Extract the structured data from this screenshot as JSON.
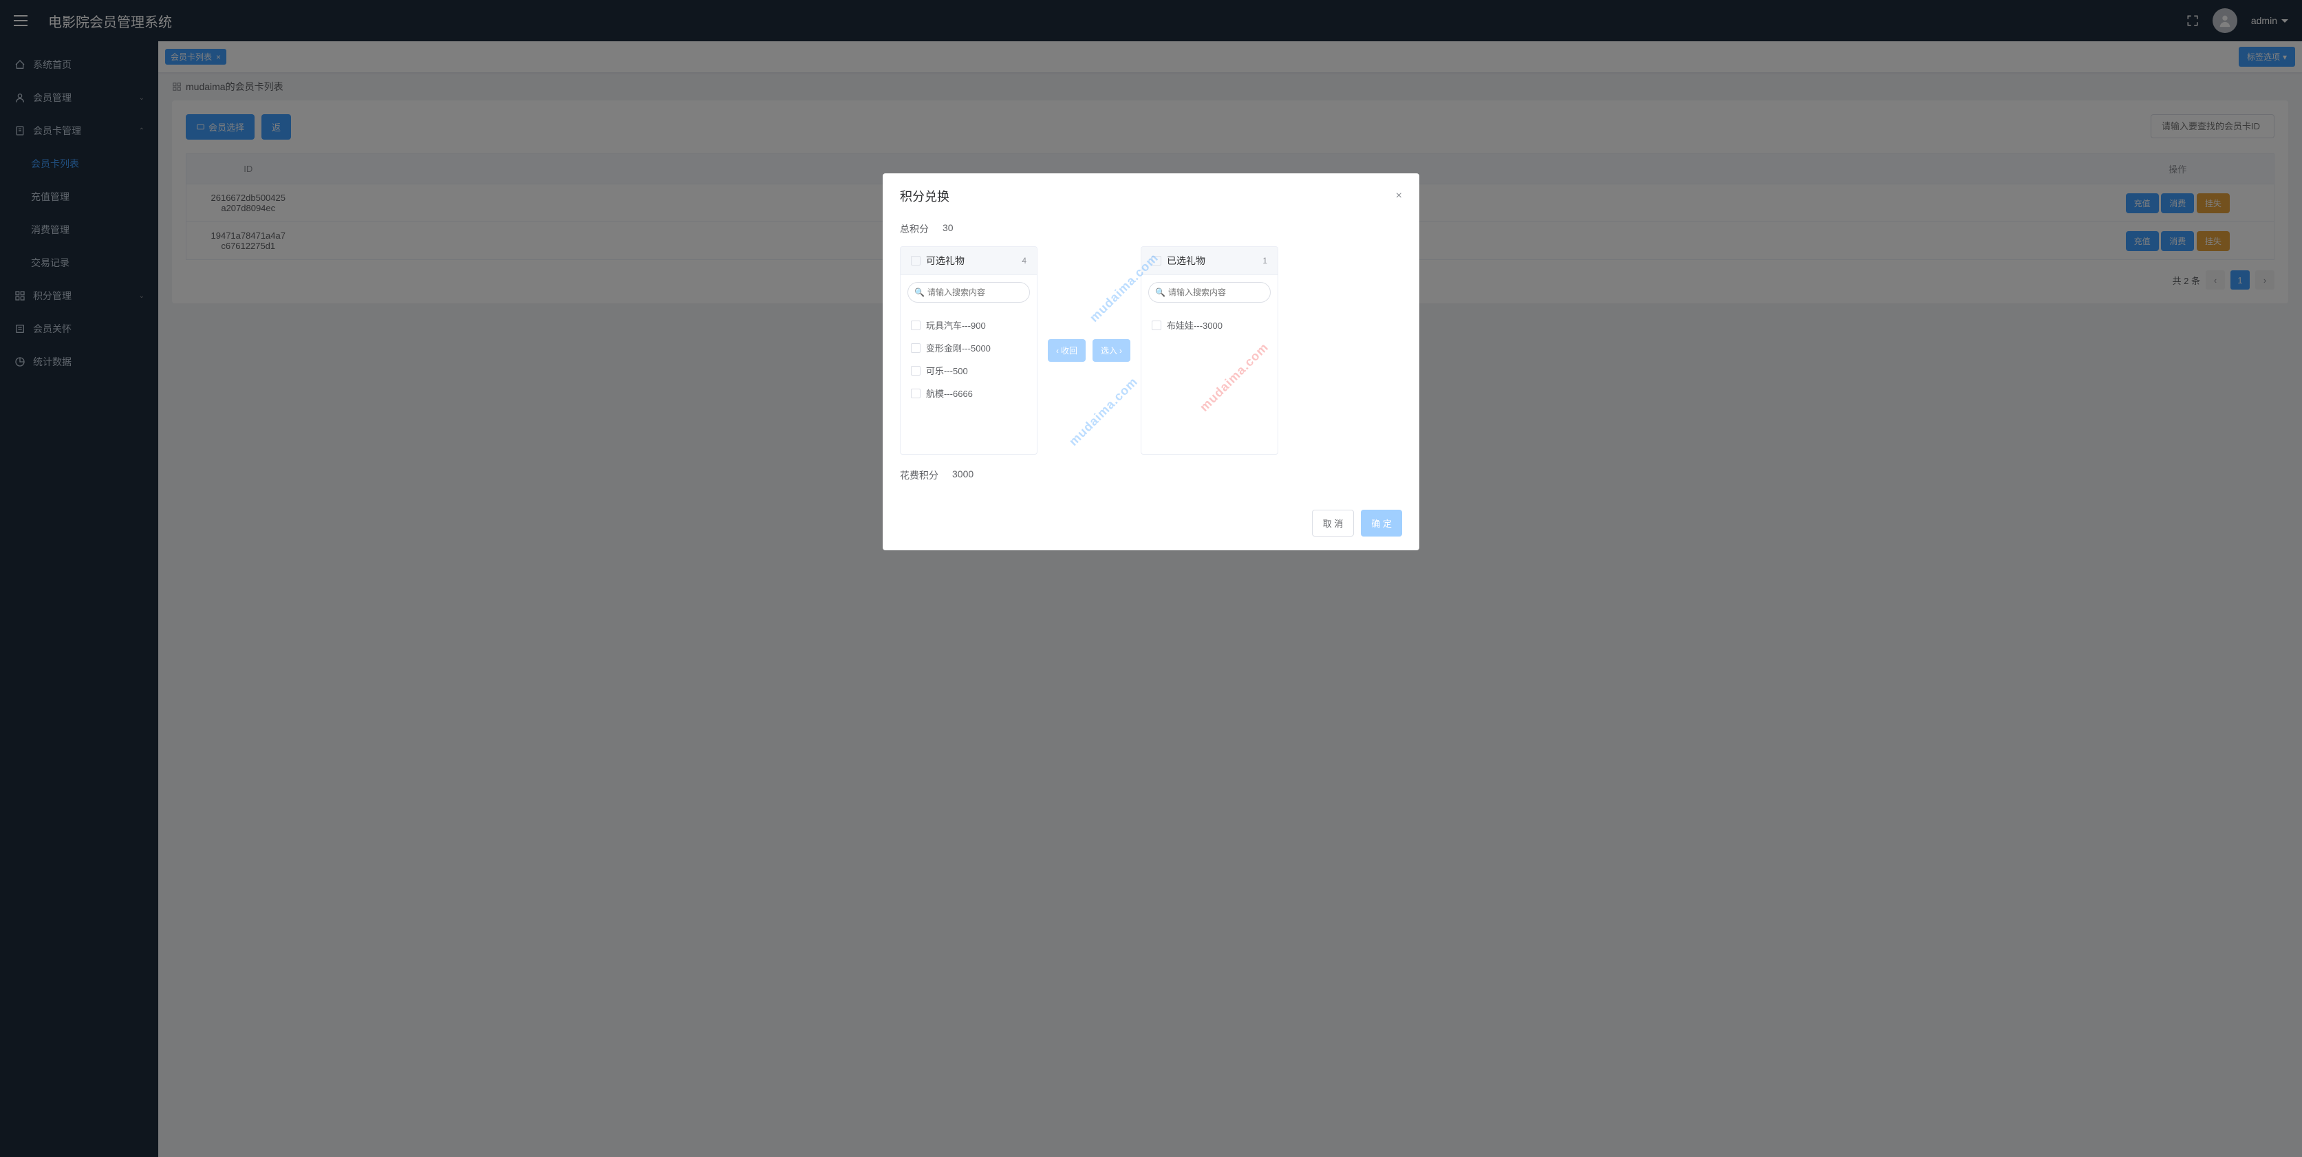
{
  "header": {
    "title": "电影院会员管理系统",
    "username": "admin"
  },
  "sidebar": {
    "items": [
      {
        "label": "系统首页",
        "icon": "home"
      },
      {
        "label": "会员管理",
        "icon": "user",
        "expandable": true
      },
      {
        "label": "会员卡管理",
        "icon": "doc",
        "expandable": true,
        "open": true,
        "children": [
          {
            "label": "会员卡列表",
            "active": true
          },
          {
            "label": "充值管理"
          },
          {
            "label": "消费管理"
          },
          {
            "label": "交易记录"
          }
        ]
      },
      {
        "label": "积分管理",
        "icon": "grid",
        "expandable": true
      },
      {
        "label": "会员关怀",
        "icon": "list"
      },
      {
        "label": "统计数据",
        "icon": "chart"
      }
    ]
  },
  "tabbar": {
    "tabs": [
      {
        "label": "会员卡列表"
      }
    ],
    "options_label": "标签选项"
  },
  "breadcrumb": "mudaima的会员卡列表",
  "toolbar": {
    "member_select": "会员选择",
    "back": "返",
    "search_placeholder": "请输入要查找的会员卡ID"
  },
  "table": {
    "cols": {
      "id": "ID",
      "ops": "操作"
    },
    "rows": [
      {
        "id": "2616672db500425\na207d8094ec"
      },
      {
        "id": "19471a78471a4a7\nc67612275d1"
      }
    ],
    "ops": {
      "recharge": "充值",
      "consume": "消费",
      "lost": "挂失"
    }
  },
  "pagination": {
    "total_label": "共 2 条",
    "page": "1"
  },
  "modal": {
    "title": "积分兑换",
    "total_points_label": "总积分",
    "total_points_value": "30",
    "cost_label": "花费积分",
    "cost_value": "3000",
    "search_placeholder": "请输入搜索内容",
    "panel_available": {
      "title": "可选礼物",
      "count": "4",
      "items": [
        "玩具汽车---900",
        "变形金刚---5000",
        "可乐---500",
        "航模---6666"
      ]
    },
    "panel_selected": {
      "title": "已选礼物",
      "count": "1",
      "items": [
        "布娃娃---3000"
      ]
    },
    "btn_left": "收回",
    "btn_right": "选入",
    "cancel": "取 消",
    "confirm": "确 定"
  },
  "watermark": "mudaima.com"
}
